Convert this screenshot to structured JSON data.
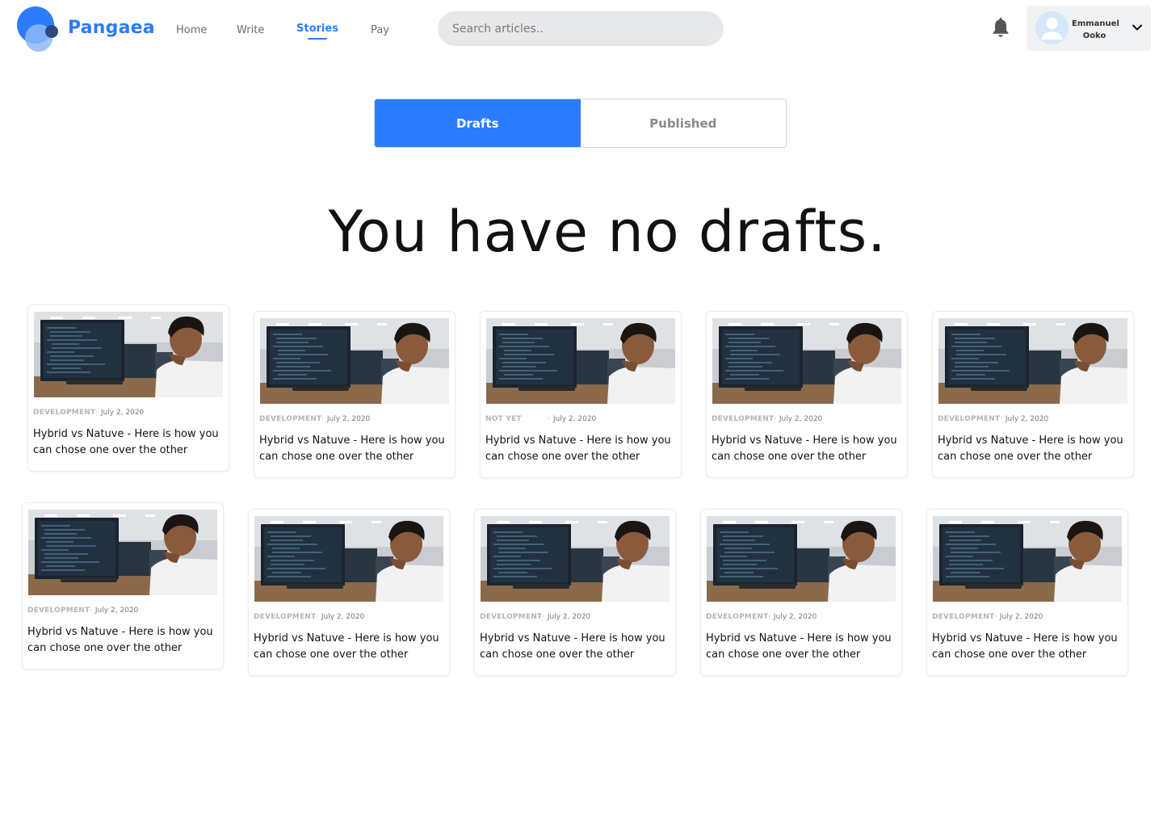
{
  "header": {
    "brand": "Pangaea",
    "nav": [
      {
        "label": "Home",
        "active": false
      },
      {
        "label": "Write",
        "active": false
      },
      {
        "label": "Stories",
        "active": true
      },
      {
        "label": "Pay",
        "active": false
      }
    ],
    "search_placeholder": "Search articles..",
    "user": {
      "first_name": "Emmanuel",
      "last_name": "Ooko"
    }
  },
  "tabs": [
    {
      "label": "Drafts",
      "active": true
    },
    {
      "label": "Published",
      "active": false
    }
  ],
  "empty_message": "You have no drafts.",
  "cards": [
    {
      "category": "DEVELOPMENT",
      "date": "July 2, 2020",
      "title": "Hybrid vs Natuve - Here is how you can chose one over the other"
    },
    {
      "category": "DEVELOPMENT",
      "date": "July 2, 2020",
      "title": "Hybrid vs Natuve - Here is how you can chose one over the other"
    },
    {
      "category": "NOT YET",
      "date": "July 2, 2020",
      "title": "Hybrid vs Natuve - Here is how you can chose one over the other"
    },
    {
      "category": "DEVELOPMENT",
      "date": "July 2, 2020",
      "title": "Hybrid vs Natuve - Here is how you can chose one over the other"
    },
    {
      "category": "DEVELOPMENT",
      "date": "July 2, 2020",
      "title": "Hybrid vs Natuve - Here is how you can chose one over the other"
    },
    {
      "category": "DEVELOPMENT",
      "date": "July 2, 2020",
      "title": "Hybrid vs Natuve - Here is how you can chose one over the other"
    },
    {
      "category": "DEVELOPMENT",
      "date": "July 2, 2020",
      "title": "Hybrid vs Natuve - Here is how you can chose one over the other"
    },
    {
      "category": "DEVELOPMENT",
      "date": "July 2, 2020",
      "title": "Hybrid vs Natuve - Here is how you can chose one over the other"
    },
    {
      "category": "DEVELOPMENT",
      "date": "July 2, 2020",
      "title": "Hybrid vs Natuve - Here is how you can chose one over the other"
    },
    {
      "category": "DEVELOPMENT",
      "date": "July 2, 2020",
      "title": "Hybrid vs Natuve - Here is how you can chose one over the other"
    }
  ],
  "colors": {
    "accent": "#2b7cff",
    "tab_inactive_text": "#8a8a8a",
    "search_bg": "#e7e8ea"
  },
  "icons": [
    "logo",
    "bell-icon",
    "avatar",
    "chevron-down-icon"
  ]
}
